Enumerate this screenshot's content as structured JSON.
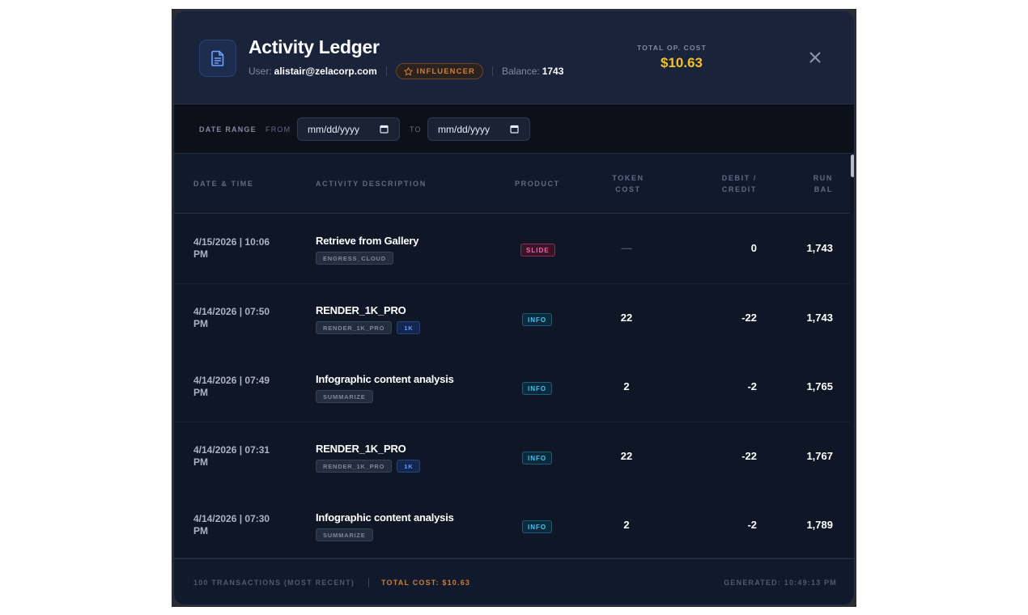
{
  "header": {
    "title": "Activity Ledger",
    "user_label": "User:",
    "user_email": "alistair@zelacorp.com",
    "tier_badge": "INFLUENCER",
    "balance_label": "Balance:",
    "balance_value": "1743",
    "total_cost_label": "TOTAL OP. COST",
    "total_cost_value": "$10.63",
    "close_icon": "close-icon",
    "doc_icon": "document-icon"
  },
  "filter": {
    "range_label": "DATE RANGE",
    "from_label": "FROM",
    "to_label": "TO",
    "from_value": "mm/dd/yyyy",
    "to_value": "mm/dd/yyyy"
  },
  "table": {
    "columns": {
      "date": "DATE & TIME",
      "desc": "ACTIVITY DESCRIPTION",
      "product": "PRODUCT",
      "token_line1": "TOKEN",
      "token_line2": "COST",
      "debit_line1": "DEBIT /",
      "debit_line2": "CREDIT",
      "bal_line1": "RUN",
      "bal_line2": "BAL"
    },
    "rows": [
      {
        "date_line1": "4/15/2026 | 10:06",
        "date_line2": "PM",
        "desc": "Retrieve from Gallery",
        "chip1": "ENGRESS_CLOUD",
        "chip2": "",
        "product": "SLIDE",
        "token": "—",
        "debit": "0",
        "bal": "1,743"
      },
      {
        "date_line1": "4/14/2026 | 07:50",
        "date_line2": "PM",
        "desc": "RENDER_1K_PRO",
        "chip1": "RENDER_1K_PRO",
        "chip2": "1K",
        "product": "INFO",
        "token": "22",
        "debit": "-22",
        "bal": "1,743"
      },
      {
        "date_line1": "4/14/2026 | 07:49",
        "date_line2": "PM",
        "desc": "Infographic content analysis",
        "chip1": "SUMMARIZE",
        "chip2": "",
        "product": "INFO",
        "token": "2",
        "debit": "-2",
        "bal": "1,765"
      },
      {
        "date_line1": "4/14/2026 | 07:31",
        "date_line2": "PM",
        "desc": "RENDER_1K_PRO",
        "chip1": "RENDER_1K_PRO",
        "chip2": "1K",
        "product": "INFO",
        "token": "22",
        "debit": "-22",
        "bal": "1,767"
      },
      {
        "date_line1": "4/14/2026 | 07:30",
        "date_line2": "PM",
        "desc": "Infographic content analysis",
        "chip1": "SUMMARIZE",
        "chip2": "",
        "product": "INFO",
        "token": "2",
        "debit": "-2",
        "bal": "1,789"
      }
    ]
  },
  "footer": {
    "count": "100 TRANSACTIONS (MOST RECENT)",
    "total_cost": "TOTAL COST: $10.63",
    "generated": "GENERATED: 10:49:13 PM"
  },
  "colors": {
    "accent_gold": "#f7c02b",
    "badge_orange": "#d07d33",
    "slide_pink": "#ff5fb0",
    "info_cyan": "#3fc6f0",
    "chip_blue": "#5f9dff"
  }
}
